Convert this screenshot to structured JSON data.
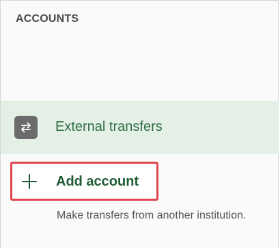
{
  "accounts_panel": {
    "title": "ACCOUNTS",
    "external_transfers": {
      "label": "External transfers",
      "icon": "transfer-arrows-icon"
    },
    "add_account": {
      "label": "Add account",
      "icon": "plus-icon",
      "description": "Make transfers from another institution."
    }
  },
  "colors": {
    "selected_row_bg": "#e4efe6",
    "link_green": "#2f6e43",
    "highlight_red": "#e0454f"
  }
}
